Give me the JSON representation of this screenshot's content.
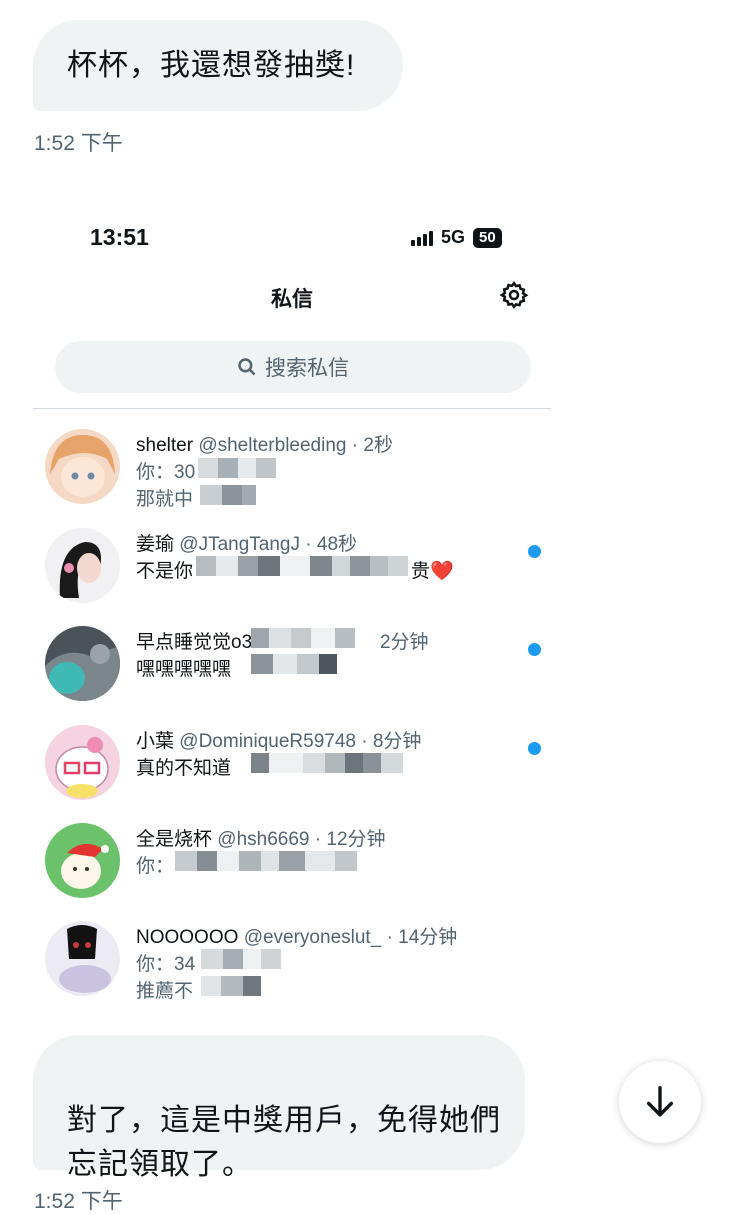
{
  "messages": [
    {
      "text": "杯杯，我還想發抽獎!",
      "time": "1:52 下午"
    },
    {
      "text": "對了，這是中獎用戶，免得她們\n忘記領取了。",
      "time": "1:52 下午"
    }
  ],
  "screenshot": {
    "status_bar": {
      "time": "13:51",
      "network": "5G",
      "battery": "50"
    },
    "title": "私信",
    "search": {
      "placeholder": "搜索私信"
    },
    "conversations": [
      {
        "name": "shelter",
        "handle": "@shelterbleeding",
        "time": "2秒",
        "preview": "你：30",
        "preview2": "那就中",
        "unread": false
      },
      {
        "name": "姜瑜",
        "handle": "@JTangTangJ",
        "time": "48秒",
        "preview": "不是你",
        "preview_tail": "贵❤️",
        "unread": true
      },
      {
        "name": "早点睡觉觉o3o",
        "handle": "",
        "time": "2分钟",
        "preview": "嘿嘿嘿嘿嘿",
        "unread": true
      },
      {
        "name": "小葉",
        "handle": "@DominiqueR59748",
        "time": "8分钟",
        "preview": "真的不知道",
        "unread": true
      },
      {
        "name": "全是烧杯",
        "handle": "@hsh6669",
        "time": "12分钟",
        "preview": "你：",
        "unread": false
      },
      {
        "name": "NOOOOOO",
        "handle": "@everyoneslut_",
        "time": "14分钟",
        "preview": "你：34",
        "preview2": "推薦不",
        "unread": false
      }
    ]
  },
  "colors": {
    "bubble": "#eff3f4",
    "unread": "#1d9bf0",
    "muted": "#536471"
  },
  "icons": [
    "settings-gear-icon",
    "search-icon",
    "arrow-down-icon"
  ]
}
